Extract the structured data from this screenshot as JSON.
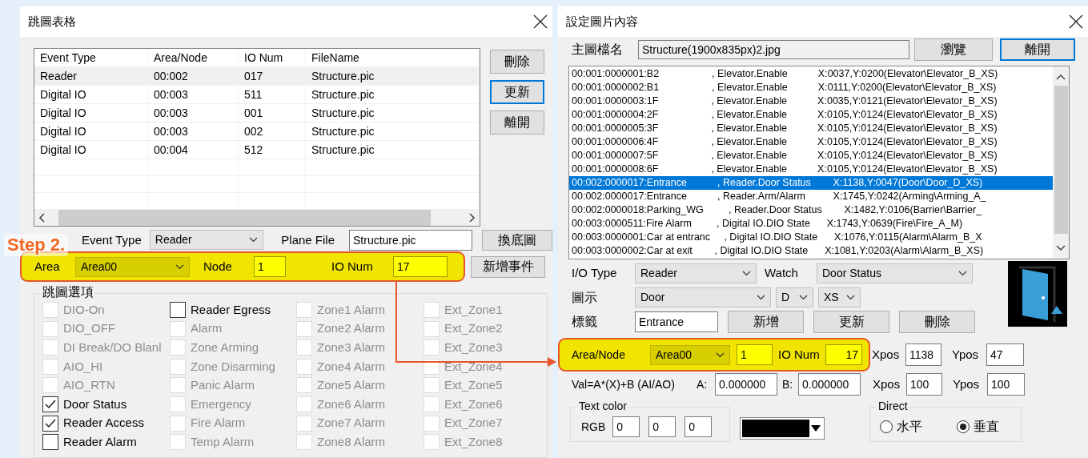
{
  "left_dialog": {
    "title": "跳圖表格",
    "table": {
      "columns": [
        "Event Type",
        "Area/Node",
        "IO Num",
        "FileName"
      ],
      "rows": [
        {
          "cells": [
            "Reader",
            "00:002",
            "017",
            "Structure.pic"
          ],
          "selected": true
        },
        {
          "cells": [
            "Digital IO",
            "00:003",
            "511",
            "Structure.pic"
          ],
          "selected": false
        },
        {
          "cells": [
            "Digital IO",
            "00:003",
            "001",
            "Structure.pic"
          ],
          "selected": false
        },
        {
          "cells": [
            "Digital IO",
            "00:003",
            "002",
            "Structure.pic"
          ],
          "selected": false
        },
        {
          "cells": [
            "Digital IO",
            "00:004",
            "512",
            "Structure.pic"
          ],
          "selected": false
        }
      ]
    },
    "buttons": [
      {
        "label": "刪除",
        "focused": false
      },
      {
        "label": "更新",
        "focused": true
      },
      {
        "label": "離開",
        "focused": false
      }
    ],
    "event_type": {
      "label": "Event Type",
      "value": "Reader"
    },
    "plane_file": {
      "label": "Plane File",
      "value": "Structure.pic"
    },
    "change_button": "換底圖",
    "step_badge": "Step 2.",
    "highlight": {
      "area_label": "Area",
      "area_value": "Area00",
      "node_label": "Node",
      "node_value": "1",
      "io_label": "IO Num",
      "io_value": "17"
    },
    "add_event_button": "新增事件",
    "options": {
      "title": "跳圖選項",
      "columns": [
        [
          {
            "label": "DIO-On",
            "checked": false,
            "disabled": true
          },
          {
            "label": "DIO_OFF",
            "checked": false,
            "disabled": true
          },
          {
            "label": "DI Break/DO Blanl",
            "checked": false,
            "disabled": true
          },
          {
            "label": "AIO_HI",
            "checked": false,
            "disabled": true
          },
          {
            "label": "AIO_RTN",
            "checked": false,
            "disabled": true
          },
          {
            "label": "Door Status",
            "checked": true,
            "disabled": false
          },
          {
            "label": "Reader Access",
            "checked": true,
            "disabled": false
          },
          {
            "label": "Reader Alarm",
            "checked": false,
            "disabled": false
          }
        ],
        [
          {
            "label": "Reader Egress",
            "checked": false,
            "disabled": false
          },
          {
            "label": "Alarm",
            "checked": false,
            "disabled": true
          },
          {
            "label": "Zone Arming",
            "checked": false,
            "disabled": true
          },
          {
            "label": "Zone Disarming",
            "checked": false,
            "disabled": true
          },
          {
            "label": "Panic Alarm",
            "checked": false,
            "disabled": true
          },
          {
            "label": "Emergency",
            "checked": false,
            "disabled": true
          },
          {
            "label": "Fire Alarm",
            "checked": false,
            "disabled": true
          },
          {
            "label": "Temp Alarm",
            "checked": false,
            "disabled": true
          }
        ],
        [
          {
            "label": "Zone1 Alarm",
            "checked": false,
            "disabled": true
          },
          {
            "label": "Zone2 Alarm",
            "checked": false,
            "disabled": true
          },
          {
            "label": "Zone3 Alarm",
            "checked": false,
            "disabled": true
          },
          {
            "label": "Zone4 Alarm",
            "checked": false,
            "disabled": true
          },
          {
            "label": "Zone5 Alarm",
            "checked": false,
            "disabled": true
          },
          {
            "label": "Zone6 Alarm",
            "checked": false,
            "disabled": true
          },
          {
            "label": "Zone7 Alarm",
            "checked": false,
            "disabled": true
          },
          {
            "label": "Zone8 Alarm",
            "checked": false,
            "disabled": true
          }
        ],
        [
          {
            "label": "Ext_Zone1",
            "checked": false,
            "disabled": true
          },
          {
            "label": "Ext_Zone2",
            "checked": false,
            "disabled": true
          },
          {
            "label": "Ext_Zone3",
            "checked": false,
            "disabled": true
          },
          {
            "label": "Ext_Zone4",
            "checked": false,
            "disabled": true
          },
          {
            "label": "Ext_Zone5",
            "checked": false,
            "disabled": true
          },
          {
            "label": "Ext_Zone6",
            "checked": false,
            "disabled": true
          },
          {
            "label": "Ext_Zone7",
            "checked": false,
            "disabled": true
          },
          {
            "label": "Ext_Zone8",
            "checked": false,
            "disabled": true
          }
        ]
      ]
    }
  },
  "right_dialog": {
    "title": "設定圖片內容",
    "main_file": {
      "label": "主圖檔名",
      "value": "Structure(1900x835px)2.jpg"
    },
    "buttons": [
      {
        "label": "瀏覽",
        "focused": false
      },
      {
        "label": "離開",
        "focused": true
      }
    ],
    "list": [
      {
        "text": "00:001:0000001:B2                   , Elevator.Enable           X:0037,Y:0200(Elevator\\Elevator_B_XS)",
        "selected": false
      },
      {
        "text": "00:001:0000002:B1                   , Elevator.Enable           X:0111,Y:0200(Elevator\\Elevator_B_XS)",
        "selected": false
      },
      {
        "text": "00:001:0000003:1F                   , Elevator.Enable           X:0035,Y:0121(Elevator\\Elevator_B_XS)",
        "selected": false
      },
      {
        "text": "00:001:0000004:2F                   , Elevator.Enable           X:0105,Y:0124(Elevator\\Elevator_B_XS)",
        "selected": false
      },
      {
        "text": "00:001:0000005:3F                   , Elevator.Enable           X:0105,Y:0124(Elevator\\Elevator_B_XS)",
        "selected": false
      },
      {
        "text": "00:001:0000006:4F                   , Elevator.Enable           X:0105,Y:0124(Elevator\\Elevator_B_XS)",
        "selected": false
      },
      {
        "text": "00:001:0000007:5F                   , Elevator.Enable           X:0105,Y:0124(Elevator\\Elevator_B_XS)",
        "selected": false
      },
      {
        "text": "00:001:0000008:6F                   , Elevator.Enable           X:0105,Y:0124(Elevator\\Elevator_B_XS)",
        "selected": false
      },
      {
        "text": "00:002:0000017:Entrance           , Reader.Door Status        X:1138,Y:0047(Door\\Door_D_XS)",
        "selected": true
      },
      {
        "text": "00:002:0000017:Entrance           , Reader.Arm/Alarm          X:1745,Y:0242(Arming\\Arming_A_",
        "selected": false
      },
      {
        "text": "00:002:0000018:Parking_WG         , Reader.Door Status        X:1482,Y:0106(Barrier\\Barrier_",
        "selected": false
      },
      {
        "text": "00:003:0000511:Fire Alarm         , Digital IO.DIO State      X:1743,Y:0639(Fire\\Fire_A_M)",
        "selected": false
      },
      {
        "text": "00:003:0000001:Car at entranc     , Digital IO.DIO State      X:1076,Y:0115(Alarm\\Alarm_B_X",
        "selected": false
      },
      {
        "text": "00:003:0000002:Car at exit        , Digital IO.DIO State      X:1081,Y:0203(Alarm\\Alarm_B_XS)",
        "selected": false
      }
    ],
    "io_type": {
      "label": "I/O Type",
      "value": "Reader"
    },
    "watch": {
      "label": "Watch",
      "value": "Door Status"
    },
    "icon_row": {
      "label": "圖示",
      "values": [
        "Door",
        "D",
        "XS"
      ]
    },
    "tag_row": {
      "label": "標籤",
      "value": "Entrance",
      "buttons": [
        "新增",
        "更新",
        "刪除"
      ]
    },
    "highlight": {
      "label": "Area/Node",
      "area_value": "Area00",
      "node_value": "1",
      "io_label": "IO Num",
      "io_value": "17"
    },
    "pos1": {
      "x_label": "Xpos",
      "x_value": "1138",
      "y_label": "Ypos",
      "y_value": "47"
    },
    "formula": {
      "text": "Val=A*(X)+B (AI/AO)",
      "a_label": "A:",
      "a_value": "0.000000",
      "b_label": "B:",
      "b_value": "0.000000"
    },
    "pos2": {
      "x_label": "Xpos",
      "x_value": "100",
      "y_label": "Ypos",
      "y_value": "100"
    },
    "text_color": {
      "title": "Text color",
      "rgb_label": "RGB",
      "values": [
        "0",
        "0",
        "0"
      ]
    },
    "direct": {
      "title": "Direct",
      "options": [
        {
          "label": "水平",
          "selected": false
        },
        {
          "label": "垂直",
          "selected": true
        }
      ]
    }
  }
}
